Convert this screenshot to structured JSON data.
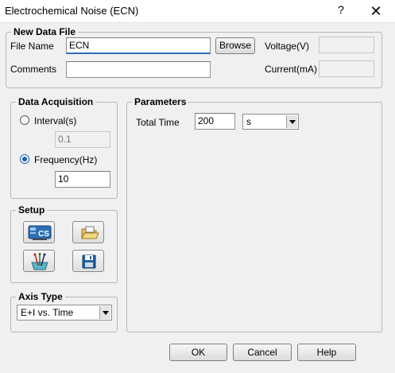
{
  "window": {
    "title": "Electrochemical Noise (ECN)",
    "help_glyph": "?",
    "close_glyph": "✕"
  },
  "new_data_file": {
    "label": "New Data File",
    "file_name_label": "File Name",
    "file_name_value": "ECN",
    "browse_label": "Browse",
    "comments_label": "Comments",
    "comments_value": "",
    "voltage_label": "Voltage(V)",
    "voltage_value": "",
    "current_label": "Current(mA)",
    "current_value": ""
  },
  "data_acquisition": {
    "label": "Data Acquisition",
    "interval_label": "Interval(s)",
    "interval_value": "0.1",
    "interval_selected": false,
    "frequency_label": "Frequency(Hz)",
    "frequency_value": "10",
    "frequency_selected": true
  },
  "setup": {
    "label": "Setup",
    "icons": [
      "cs-settings-icon",
      "open-folder-icon",
      "electrode-icon",
      "save-icon"
    ]
  },
  "axis_type": {
    "label": "Axis Type",
    "selected": "E+I vs. Time"
  },
  "parameters": {
    "label": "Parameters",
    "total_time_label": "Total Time",
    "total_time_value": "200",
    "unit_selected": "s"
  },
  "buttons": {
    "ok": "OK",
    "cancel": "Cancel",
    "help": "Help"
  },
  "colors": {
    "accent": "#1a5fb4",
    "background": "#f0f0f0"
  }
}
